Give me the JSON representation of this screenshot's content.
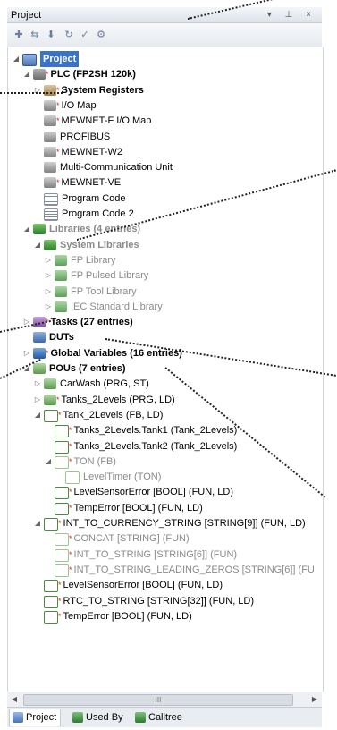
{
  "panel": {
    "title": "Project",
    "controls": "▾ ⊥ ×"
  },
  "toolbar": {
    "icons": [
      "tree-new-icon",
      "tree-move-icon",
      "tree-down-icon",
      "tree-refresh-icon",
      "tree-check-icon",
      "tree-settings-icon"
    ]
  },
  "tree": [
    {
      "label": "Project",
      "depth": 0,
      "icon": "ic-proj",
      "expand": "◢",
      "style": "sel"
    },
    {
      "label": "PLC (FP2SH 120k)",
      "depth": 1,
      "icon": "ic-plc",
      "expand": "◢",
      "style": "bold",
      "star": true
    },
    {
      "label": "System Registers",
      "depth": 2,
      "icon": "ic-reg",
      "expand": "▷",
      "style": "bold",
      "star": true
    },
    {
      "label": "I/O Map",
      "depth": 2,
      "icon": "ic-map",
      "expand": "",
      "style": "",
      "star": true
    },
    {
      "label": "MEWNET-F I/O Map",
      "depth": 2,
      "icon": "ic-map",
      "expand": "",
      "style": "",
      "star": true
    },
    {
      "label": "PROFIBUS",
      "depth": 2,
      "icon": "ic-map",
      "expand": "",
      "style": ""
    },
    {
      "label": "MEWNET-W2",
      "depth": 2,
      "icon": "ic-map",
      "expand": "",
      "style": "",
      "star": true
    },
    {
      "label": "Multi-Communication Unit",
      "depth": 2,
      "icon": "ic-map",
      "expand": "",
      "style": ""
    },
    {
      "label": "MEWNET-VE",
      "depth": 2,
      "icon": "ic-map",
      "expand": "",
      "style": "",
      "star": true
    },
    {
      "label": "Program Code",
      "depth": 2,
      "icon": "ic-list",
      "expand": "",
      "style": ""
    },
    {
      "label": "Program Code 2",
      "depth": 2,
      "icon": "ic-list",
      "expand": "",
      "style": ""
    },
    {
      "label": "Libraries (4 entries)",
      "depth": 1,
      "icon": "ic-book",
      "expand": "◢",
      "style": "bold grey"
    },
    {
      "label": "System Libraries",
      "depth": 2,
      "icon": "ic-book",
      "expand": "◢",
      "style": "bold grey"
    },
    {
      "label": "FP Library",
      "depth": 3,
      "icon": "ic-lib",
      "expand": "▷",
      "style": "grey"
    },
    {
      "label": "FP Pulsed Library",
      "depth": 3,
      "icon": "ic-lib",
      "expand": "▷",
      "style": "grey"
    },
    {
      "label": "FP Tool Library",
      "depth": 3,
      "icon": "ic-lib",
      "expand": "▷",
      "style": "grey"
    },
    {
      "label": "IEC Standard Library",
      "depth": 3,
      "icon": "ic-lib",
      "expand": "▷",
      "style": "grey"
    },
    {
      "label": "Tasks (27 entries)",
      "depth": 1,
      "icon": "ic-task",
      "expand": "▷",
      "style": "bold",
      "star": true
    },
    {
      "label": "DUTs",
      "depth": 1,
      "icon": "ic-dut",
      "expand": "",
      "style": "bold"
    },
    {
      "label": "Global Variables (16 entries)",
      "depth": 1,
      "icon": "ic-gv",
      "expand": "▷",
      "style": "bold",
      "star": true
    },
    {
      "label": "POUs (7 entries)",
      "depth": 1,
      "icon": "ic-pou",
      "expand": "◢",
      "style": "bold"
    },
    {
      "label": "CarWash (PRG, ST)",
      "depth": 2,
      "icon": "ic-pou",
      "expand": "▷",
      "style": ""
    },
    {
      "label": "Tanks_2Levels (PRG, LD)",
      "depth": 2,
      "icon": "ic-pou",
      "expand": "▷",
      "style": "",
      "star": true
    },
    {
      "label": "Tank_2Levels (FB, LD)",
      "depth": 2,
      "icon": "ic-fb",
      "expand": "◢",
      "style": "",
      "star": true
    },
    {
      "label": "Tanks_2Levels.Tank1 (Tank_2Levels)",
      "depth": 3,
      "icon": "ic-fb",
      "expand": "",
      "style": "",
      "star": true
    },
    {
      "label": "Tanks_2Levels.Tank2 (Tank_2Levels)",
      "depth": 3,
      "icon": "ic-fb",
      "expand": "",
      "style": "",
      "star": true
    },
    {
      "label": "TON (FB)",
      "depth": 3,
      "icon": "ic-fbg",
      "expand": "◢",
      "style": "grey",
      "star": true
    },
    {
      "label": "LevelTimer (TON)",
      "depth": 4,
      "icon": "ic-fbg",
      "expand": "",
      "style": "grey"
    },
    {
      "label": "LevelSensorError [BOOL] (FUN, LD)",
      "depth": 3,
      "icon": "ic-fb",
      "expand": "",
      "style": "",
      "star": true
    },
    {
      "label": "TempError [BOOL] (FUN, LD)",
      "depth": 3,
      "icon": "ic-fb",
      "expand": "",
      "style": "",
      "star": true
    },
    {
      "label": "INT_TO_CURRENCY_STRING [STRING[9]] (FUN, LD)",
      "depth": 2,
      "icon": "ic-fb",
      "expand": "◢",
      "style": "",
      "star": true
    },
    {
      "label": "CONCAT [STRING] (FUN)",
      "depth": 3,
      "icon": "ic-fbg",
      "expand": "",
      "style": "grey",
      "star": true
    },
    {
      "label": "INT_TO_STRING [STRING[6]] (FUN)",
      "depth": 3,
      "icon": "ic-fbg",
      "expand": "",
      "style": "grey",
      "star": true
    },
    {
      "label": "INT_TO_STRING_LEADING_ZEROS [STRING[6]] (FU",
      "depth": 3,
      "icon": "ic-fbg",
      "expand": "",
      "style": "grey",
      "star": true
    },
    {
      "label": "LevelSensorError [BOOL] (FUN, LD)",
      "depth": 2,
      "icon": "ic-fb",
      "expand": "",
      "style": "",
      "star": true
    },
    {
      "label": "RTC_TO_STRING [STRING[32]] (FUN, LD)",
      "depth": 2,
      "icon": "ic-fb",
      "expand": "",
      "style": "",
      "star": true
    },
    {
      "label": "TempError [BOOL] (FUN, LD)",
      "depth": 2,
      "icon": "ic-fb",
      "expand": "",
      "style": "",
      "star": true
    }
  ],
  "scrollbar": {
    "thumb_label": "III"
  },
  "tabs": [
    {
      "label": "Project",
      "active": true
    },
    {
      "label": "Used By",
      "active": false
    },
    {
      "label": "Calltree",
      "active": false
    }
  ],
  "colors": {
    "selection": "#3a73c9",
    "star": "#dd2222",
    "grey_text": "#8a8a8a"
  }
}
